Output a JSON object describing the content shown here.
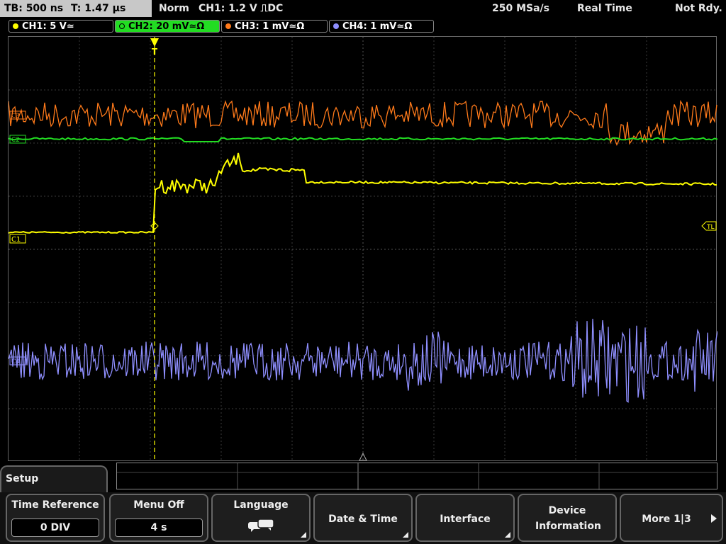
{
  "status": {
    "timebase": "TB: 500 ns",
    "trigger_time": "T: 1.47 µs",
    "mode": "Norm",
    "trigger": "CH1: 1.2 V ⎍DC",
    "sample_rate": "250 MSa/s",
    "acq_mode": "Real Time",
    "state": "Not Rdy."
  },
  "channels": [
    {
      "label": "CH1: 5 V≃",
      "color": "#ffff00"
    },
    {
      "label": "CH2: 20 mV≃Ω",
      "color": "#22dd22"
    },
    {
      "label": "CH3: 1 mV≃Ω",
      "color": "#ff7a1a"
    },
    {
      "label": "CH4: 1 mV≃Ω",
      "color": "#8f8fff"
    }
  ],
  "markers": {
    "ch1": "C1",
    "ch2": "C2",
    "ch3": "C3",
    "ch4": "C4",
    "trigger_level": "TL",
    "trigger_pos": "T"
  },
  "menu": {
    "title": "Setup",
    "softkeys": [
      {
        "title": "Time Reference",
        "value": "0 DIV"
      },
      {
        "title": "Menu Off",
        "value": "4 s"
      },
      {
        "title": "Language",
        "icon": "speech-bubbles-icon"
      },
      {
        "title": "Date & Time"
      },
      {
        "title": "Interface"
      },
      {
        "title": "Device Information"
      },
      {
        "title": "More 1|3"
      }
    ]
  }
}
